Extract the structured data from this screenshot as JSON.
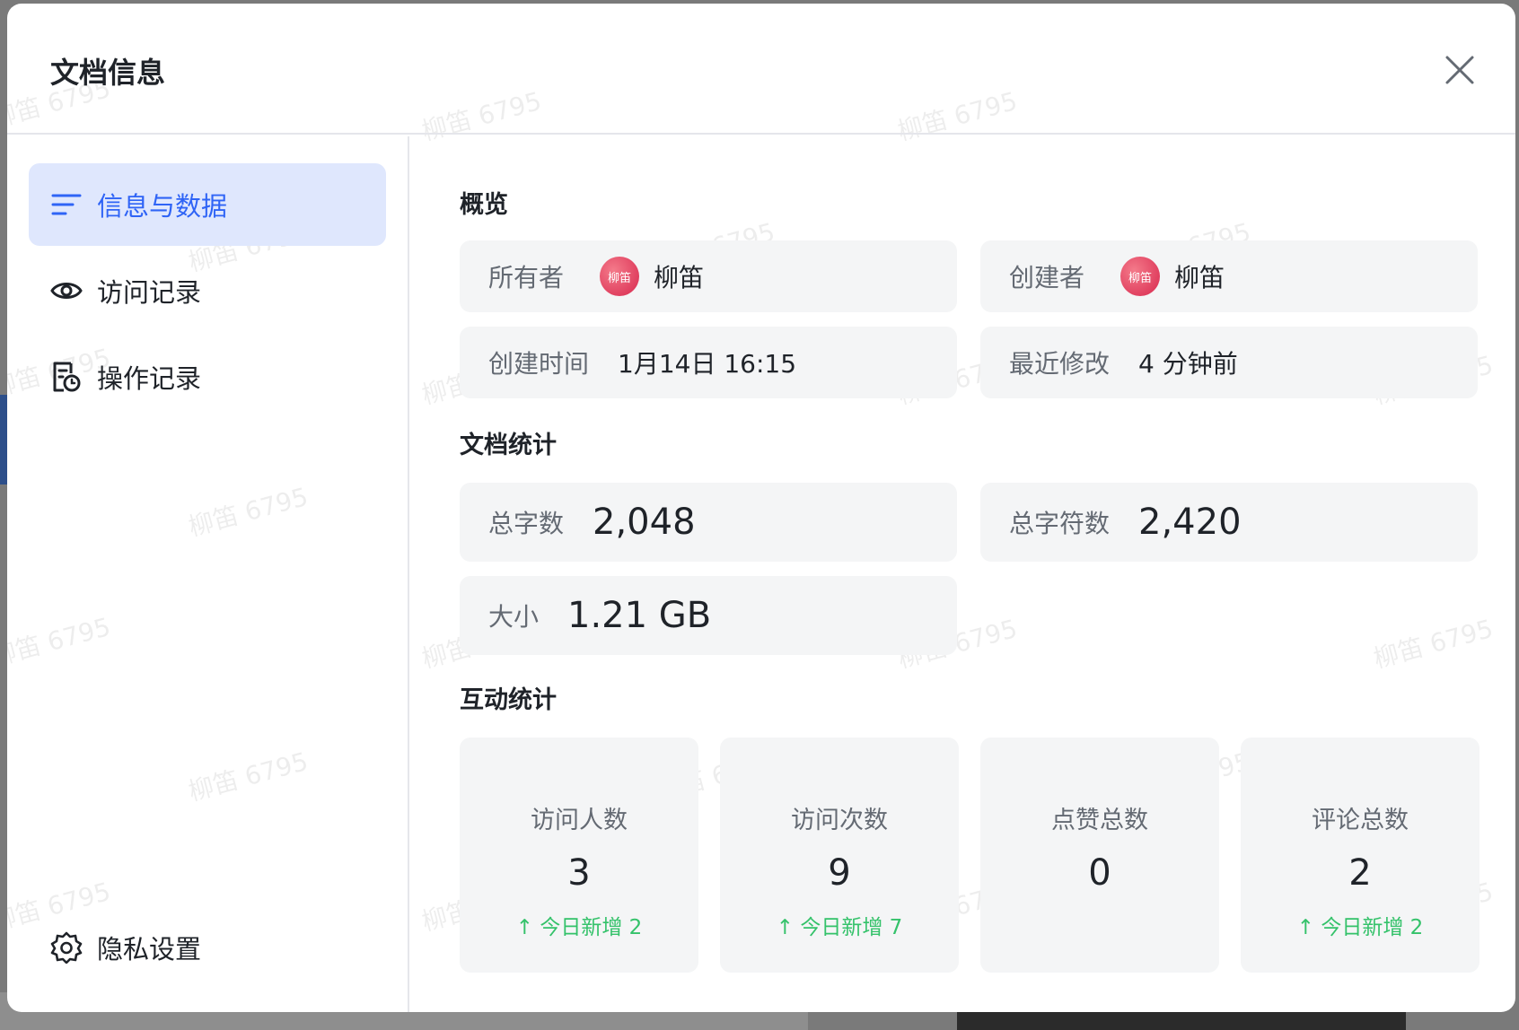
{
  "modal": {
    "title": "文档信息"
  },
  "sidebar": {
    "items": [
      {
        "label": "信息与数据",
        "icon": "list-icon",
        "active": true
      },
      {
        "label": "访问记录",
        "icon": "eye-icon",
        "active": false
      },
      {
        "label": "操作记录",
        "icon": "history-doc-icon",
        "active": false
      }
    ],
    "bottom": {
      "label": "隐私设置",
      "icon": "gear-icon"
    }
  },
  "overview": {
    "title": "概览",
    "owner_label": "所有者",
    "owner_name": "柳笛",
    "creator_label": "创建者",
    "creator_name": "柳笛",
    "avatar_text": "柳笛",
    "created_label": "创建时间",
    "created_value": "1月14日 16:15",
    "modified_label": "最近修改",
    "modified_value": "4 分钟前"
  },
  "doc_stats": {
    "title": "文档统计",
    "words_label": "总字数",
    "words_value": "2,048",
    "chars_label": "总字符数",
    "chars_value": "2,420",
    "size_label": "大小",
    "size_value": "1.21 GB"
  },
  "interaction": {
    "title": "互动统计",
    "cards": [
      {
        "label": "访问人数",
        "value": "3",
        "delta": "↑ 今日新增 2"
      },
      {
        "label": "访问次数",
        "value": "9",
        "delta": "↑ 今日新增 7"
      },
      {
        "label": "点赞总数",
        "value": "0",
        "delta": ""
      },
      {
        "label": "评论总数",
        "value": "2",
        "delta": "↑ 今日新增 2"
      }
    ]
  },
  "watermark": "柳笛 6795",
  "colors": {
    "accent": "#2f64f6",
    "active_bg": "#dfe7fd",
    "card_bg": "#f4f5f6",
    "positive": "#34c26a"
  }
}
